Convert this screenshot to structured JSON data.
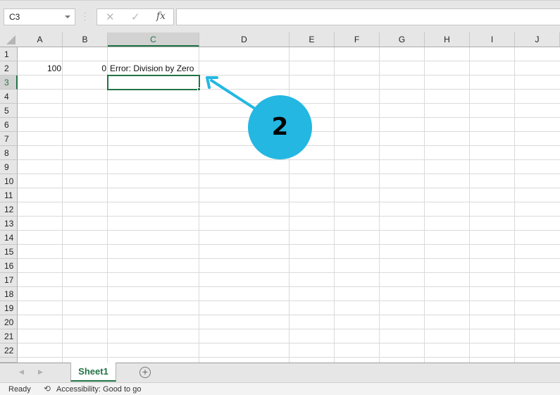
{
  "formula_bar": {
    "name_box": "C3",
    "cancel_icon": "✕",
    "enter_icon": "✓",
    "fx_label": "fx",
    "formula": ""
  },
  "columns": [
    "A",
    "B",
    "C",
    "D",
    "E",
    "F",
    "G",
    "H",
    "I",
    "J"
  ],
  "selected_column": "C",
  "rows": [
    "1",
    "2",
    "3",
    "4",
    "5",
    "6",
    "7",
    "8",
    "9",
    "10",
    "11",
    "12",
    "13",
    "14",
    "15",
    "16",
    "17",
    "18",
    "19",
    "20",
    "21",
    "22"
  ],
  "selected_row": "3",
  "cells": {
    "A2": "100",
    "B2": "0",
    "C2": "Error: Division by Zero"
  },
  "selected_cell": "C3",
  "annotation": {
    "badge_label": "2",
    "color": "#23b7e2"
  },
  "sheet_tabs": {
    "prev_icon": "◀",
    "next_icon": "▶",
    "tabs": [
      "Sheet1"
    ],
    "active": "Sheet1",
    "add_icon": "+"
  },
  "status_bar": {
    "ready": "Ready",
    "accessibility": "Accessibility: Good to go"
  },
  "colors": {
    "accent": "#217346"
  }
}
